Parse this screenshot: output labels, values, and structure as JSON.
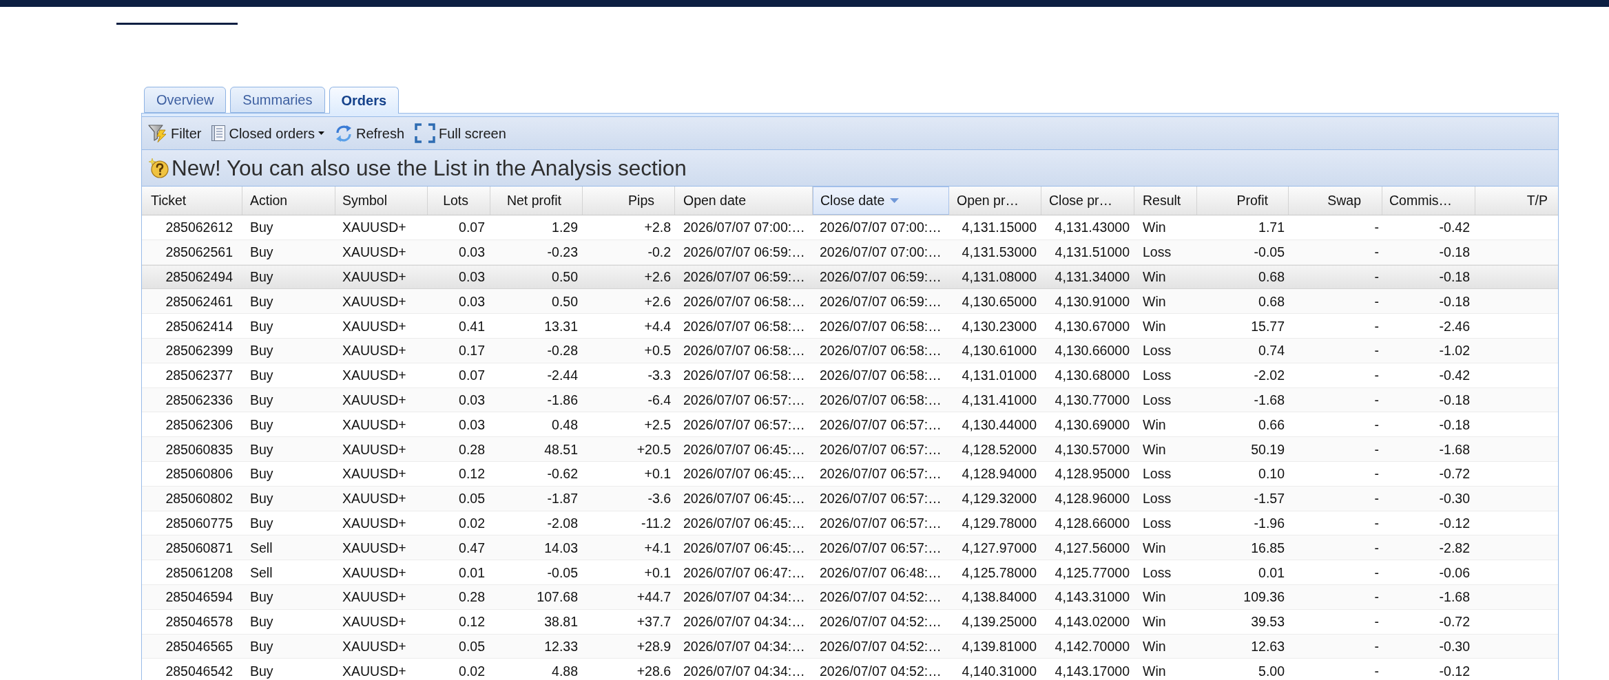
{
  "tabs": [
    {
      "label": "Overview",
      "selected": false
    },
    {
      "label": "Summaries",
      "selected": false
    },
    {
      "label": "Orders",
      "selected": true
    }
  ],
  "toolbar": {
    "buttons": [
      {
        "kind": "filter",
        "label": "Filter"
      },
      {
        "kind": "menu",
        "label": "Closed orders"
      },
      {
        "kind": "refresh",
        "label": "Refresh"
      },
      {
        "kind": "fullscreen",
        "label": "Full screen"
      }
    ]
  },
  "banner": {
    "text": "New! You can also use the List in the Analysis section"
  },
  "table": {
    "columns": [
      {
        "label": "Ticket",
        "sorted": false
      },
      {
        "label": "Action",
        "sorted": false
      },
      {
        "label": "Symbol",
        "sorted": false
      },
      {
        "label": "Lots",
        "sorted": false
      },
      {
        "label": "Net profit",
        "sorted": false
      },
      {
        "label": "Pips",
        "sorted": false
      },
      {
        "label": "Open date",
        "sorted": false
      },
      {
        "label": "Close date",
        "sorted": true
      },
      {
        "label": "Open pr…",
        "sorted": false
      },
      {
        "label": "Close pr…",
        "sorted": false
      },
      {
        "label": "Result",
        "sorted": false
      },
      {
        "label": "Profit",
        "sorted": false
      },
      {
        "label": "Swap",
        "sorted": false
      },
      {
        "label": "Commis…",
        "sorted": false
      },
      {
        "label": "T/P",
        "sorted": false
      }
    ],
    "rows": [
      {
        "highlighted": false,
        "cells": [
          "285062612",
          "Buy",
          "XAUUSD+",
          "0.07",
          "1.29",
          "+2.8",
          "2026/07/07 07:00:…",
          "2026/07/07 07:00:…",
          "4,131.15000",
          "4,131.43000",
          "Win",
          "1.71",
          "-",
          "-0.42"
        ]
      },
      {
        "highlighted": false,
        "cells": [
          "285062561",
          "Buy",
          "XAUUSD+",
          "0.03",
          "-0.23",
          "-0.2",
          "2026/07/07 06:59:…",
          "2026/07/07 07:00:…",
          "4,131.53000",
          "4,131.51000",
          "Loss",
          "-0.05",
          "-",
          "-0.18"
        ]
      },
      {
        "highlighted": true,
        "cells": [
          "285062494",
          "Buy",
          "XAUUSD+",
          "0.03",
          "0.50",
          "+2.6",
          "2026/07/07 06:59:…",
          "2026/07/07 06:59:…",
          "4,131.08000",
          "4,131.34000",
          "Win",
          "0.68",
          "-",
          "-0.18"
        ]
      },
      {
        "highlighted": false,
        "cells": [
          "285062461",
          "Buy",
          "XAUUSD+",
          "0.03",
          "0.50",
          "+2.6",
          "2026/07/07 06:58:…",
          "2026/07/07 06:59:…",
          "4,130.65000",
          "4,130.91000",
          "Win",
          "0.68",
          "-",
          "-0.18"
        ]
      },
      {
        "highlighted": false,
        "cells": [
          "285062414",
          "Buy",
          "XAUUSD+",
          "0.41",
          "13.31",
          "+4.4",
          "2026/07/07 06:58:…",
          "2026/07/07 06:58:…",
          "4,130.23000",
          "4,130.67000",
          "Win",
          "15.77",
          "-",
          "-2.46"
        ]
      },
      {
        "highlighted": false,
        "cells": [
          "285062399",
          "Buy",
          "XAUUSD+",
          "0.17",
          "-0.28",
          "+0.5",
          "2026/07/07 06:58:…",
          "2026/07/07 06:58:…",
          "4,130.61000",
          "4,130.66000",
          "Loss",
          "0.74",
          "-",
          "-1.02"
        ]
      },
      {
        "highlighted": false,
        "cells": [
          "285062377",
          "Buy",
          "XAUUSD+",
          "0.07",
          "-2.44",
          "-3.3",
          "2026/07/07 06:58:…",
          "2026/07/07 06:58:…",
          "4,131.01000",
          "4,130.68000",
          "Loss",
          "-2.02",
          "-",
          "-0.42"
        ]
      },
      {
        "highlighted": false,
        "cells": [
          "285062336",
          "Buy",
          "XAUUSD+",
          "0.03",
          "-1.86",
          "-6.4",
          "2026/07/07 06:57:…",
          "2026/07/07 06:58:…",
          "4,131.41000",
          "4,130.77000",
          "Loss",
          "-1.68",
          "-",
          "-0.18"
        ]
      },
      {
        "highlighted": false,
        "cells": [
          "285062306",
          "Buy",
          "XAUUSD+",
          "0.03",
          "0.48",
          "+2.5",
          "2026/07/07 06:57:…",
          "2026/07/07 06:57:…",
          "4,130.44000",
          "4,130.69000",
          "Win",
          "0.66",
          "-",
          "-0.18"
        ]
      },
      {
        "highlighted": false,
        "cells": [
          "285060835",
          "Buy",
          "XAUUSD+",
          "0.28",
          "48.51",
          "+20.5",
          "2026/07/07 06:45:…",
          "2026/07/07 06:57:…",
          "4,128.52000",
          "4,130.57000",
          "Win",
          "50.19",
          "-",
          "-1.68"
        ]
      },
      {
        "highlighted": false,
        "cells": [
          "285060806",
          "Buy",
          "XAUUSD+",
          "0.12",
          "-0.62",
          "+0.1",
          "2026/07/07 06:45:…",
          "2026/07/07 06:57:…",
          "4,128.94000",
          "4,128.95000",
          "Loss",
          "0.10",
          "-",
          "-0.72"
        ]
      },
      {
        "highlighted": false,
        "cells": [
          "285060802",
          "Buy",
          "XAUUSD+",
          "0.05",
          "-1.87",
          "-3.6",
          "2026/07/07 06:45:…",
          "2026/07/07 06:57:…",
          "4,129.32000",
          "4,128.96000",
          "Loss",
          "-1.57",
          "-",
          "-0.30"
        ]
      },
      {
        "highlighted": false,
        "cells": [
          "285060775",
          "Buy",
          "XAUUSD+",
          "0.02",
          "-2.08",
          "-11.2",
          "2026/07/07 06:45:…",
          "2026/07/07 06:57:…",
          "4,129.78000",
          "4,128.66000",
          "Loss",
          "-1.96",
          "-",
          "-0.12"
        ]
      },
      {
        "highlighted": false,
        "cells": [
          "285060871",
          "Sell",
          "XAUUSD+",
          "0.47",
          "14.03",
          "+4.1",
          "2026/07/07 06:45:…",
          "2026/07/07 06:57:…",
          "4,127.97000",
          "4,127.56000",
          "Win",
          "16.85",
          "-",
          "-2.82"
        ]
      },
      {
        "highlighted": false,
        "cells": [
          "285061208",
          "Sell",
          "XAUUSD+",
          "0.01",
          "-0.05",
          "+0.1",
          "2026/07/07 06:47:…",
          "2026/07/07 06:48:…",
          "4,125.78000",
          "4,125.77000",
          "Loss",
          "0.01",
          "-",
          "-0.06"
        ]
      },
      {
        "highlighted": false,
        "cells": [
          "285046594",
          "Buy",
          "XAUUSD+",
          "0.28",
          "107.68",
          "+44.7",
          "2026/07/07 04:34:…",
          "2026/07/07 04:52:…",
          "4,138.84000",
          "4,143.31000",
          "Win",
          "109.36",
          "-",
          "-1.68"
        ]
      },
      {
        "highlighted": false,
        "cells": [
          "285046578",
          "Buy",
          "XAUUSD+",
          "0.12",
          "38.81",
          "+37.7",
          "2026/07/07 04:34:…",
          "2026/07/07 04:52:…",
          "4,139.25000",
          "4,143.02000",
          "Win",
          "39.53",
          "-",
          "-0.72"
        ]
      },
      {
        "highlighted": false,
        "cells": [
          "285046565",
          "Buy",
          "XAUUSD+",
          "0.05",
          "12.33",
          "+28.9",
          "2026/07/07 04:34:…",
          "2026/07/07 04:52:…",
          "4,139.81000",
          "4,142.70000",
          "Win",
          "12.63",
          "-",
          "-0.30"
        ]
      },
      {
        "highlighted": false,
        "cells": [
          "285046542",
          "Buy",
          "XAUUSD+",
          "0.02",
          "4.88",
          "+28.6",
          "2026/07/07 04:34:…",
          "2026/07/07 04:52:…",
          "4,140.31000",
          "4,143.17000",
          "Win",
          "5.00",
          "-",
          "-0.12"
        ]
      }
    ]
  }
}
